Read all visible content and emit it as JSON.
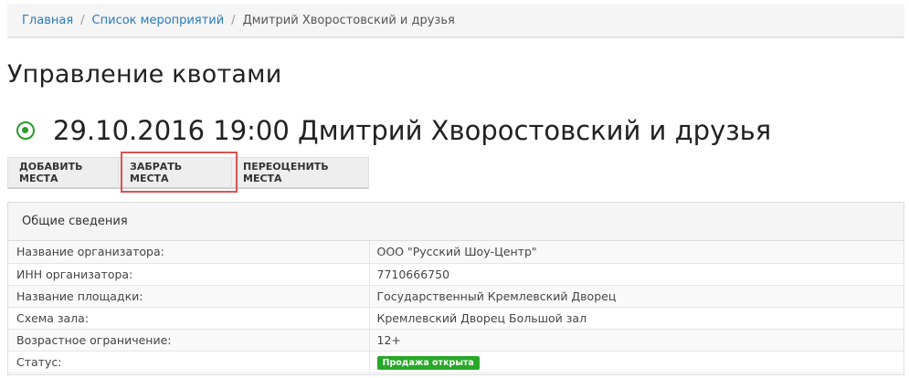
{
  "breadcrumb": {
    "items": [
      "Главная",
      "Список мероприятий"
    ],
    "separator": "/",
    "current": "Дмитрий Хворостовский и друзья"
  },
  "page": {
    "title": "Управление квотами"
  },
  "event": {
    "icon": "dot-circle-icon",
    "icon_color": "#2a9a2a",
    "title": "29.10.2016 19:00 Дмитрий Хворостовский и друзья"
  },
  "toolbar": {
    "add_label": "ДОБАВИТЬ МЕСТА",
    "take_label": "ЗАБРАТЬ МЕСТА",
    "reprice_label": "ПЕРЕОЦЕНИТЬ МЕСТА",
    "highlight_color": "#d9534f"
  },
  "panel": {
    "title": "Общие сведения",
    "rows": [
      {
        "key": "Название организатора:",
        "value": "ООО \"Русский Шоу-Центр\""
      },
      {
        "key": "ИНН организатора:",
        "value": "7710666750"
      },
      {
        "key": "Название площадки:",
        "value": "Государственный Кремлевский Дворец"
      },
      {
        "key": "Схема зала:",
        "value": "Кремлевский Дворец Большой зал"
      },
      {
        "key": "Возрастное ограничение:",
        "value": "12+"
      },
      {
        "key": "Статус:",
        "value": "Продажа открыта"
      }
    ],
    "status_color": "#28a828"
  }
}
